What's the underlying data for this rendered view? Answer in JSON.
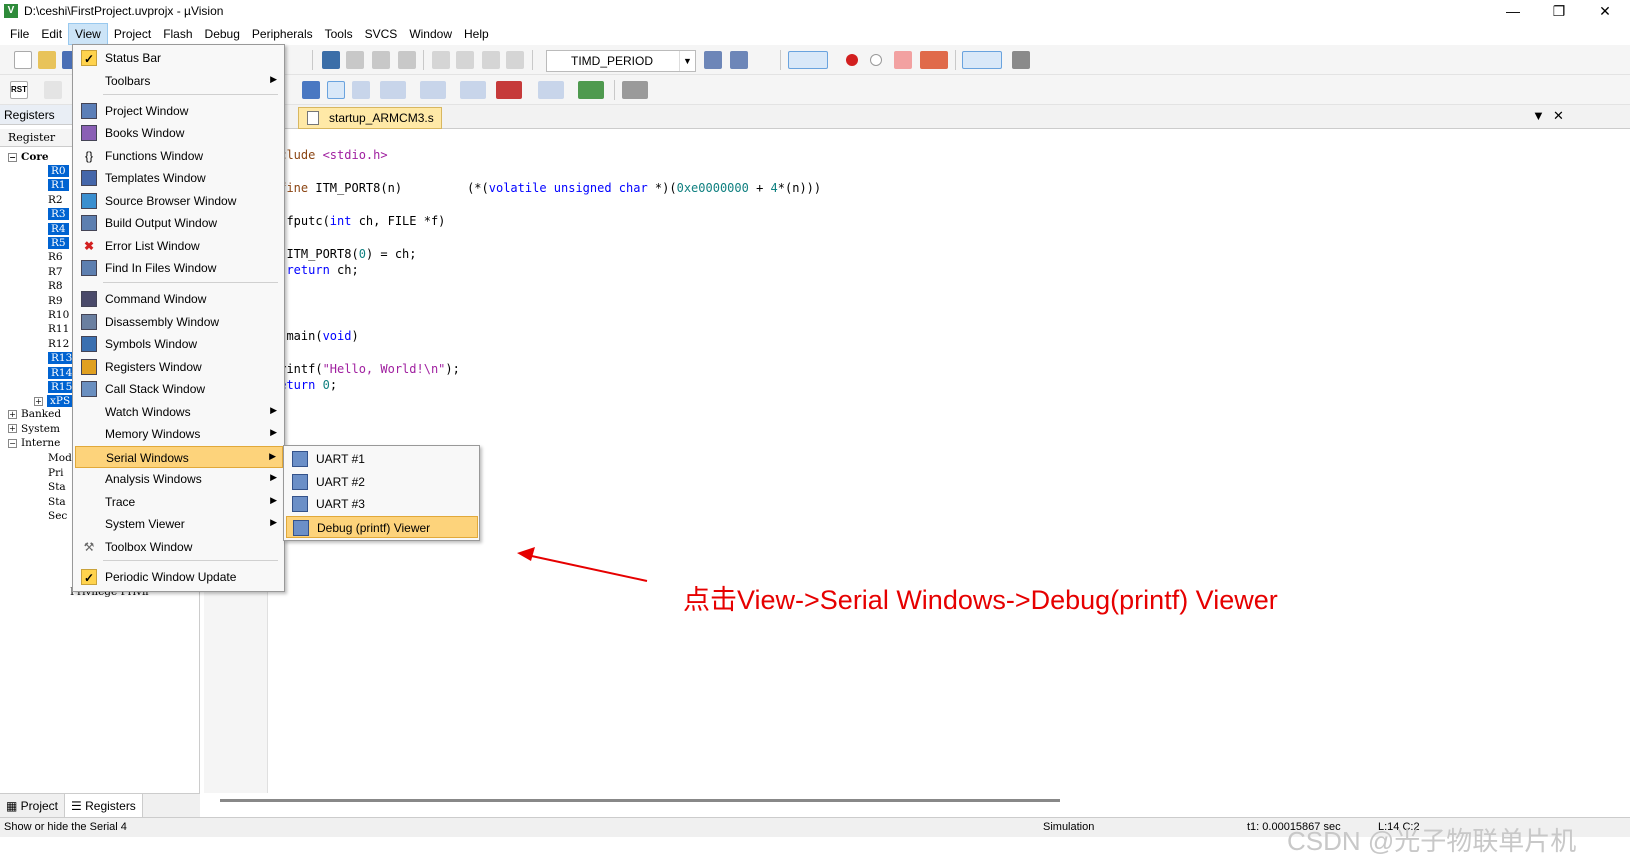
{
  "window": {
    "title": "D:\\ceshi\\FirstProject.uvprojx - µVision",
    "min": "—",
    "max": "❐",
    "close": "✕"
  },
  "menubar": [
    "File",
    "Edit",
    "View",
    "Project",
    "Flash",
    "Debug",
    "Peripherals",
    "Tools",
    "SVCS",
    "Window",
    "Help"
  ],
  "toolbar": {
    "target_combo": "TIMD_PERIOD",
    "rst_label": "RST"
  },
  "left_panel": {
    "title": "Registers",
    "header": "Register",
    "core_label": "Core",
    "registers": [
      "R0",
      "R1",
      "R2",
      "R3",
      "R4",
      "R5",
      "R6",
      "R7",
      "R8",
      "R9",
      "R10",
      "R11",
      "R12",
      "R13",
      "R14",
      "R15",
      "xPS"
    ],
    "groups": [
      "Banked",
      "System",
      "Interne"
    ],
    "internal_children": [
      "Mod",
      "Pri",
      "Sta",
      "Sta",
      "Sec"
    ],
    "partial_row": "Privilege   Privil"
  },
  "bottom_tabs": [
    "Project",
    "Registers"
  ],
  "editor": {
    "tab": "startup_ARMCM3.s",
    "lines": [
      {
        "segments": [
          {
            "t": "nclude ",
            "c": "pp"
          },
          {
            "t": "<stdio.h>",
            "c": "str"
          }
        ]
      },
      {
        "segments": [
          {
            "t": "efine ",
            "c": "pp"
          },
          {
            "t": "ITM_PORT8(n)         (*(",
            "c": ""
          },
          {
            "t": "volatile unsigned char",
            "c": "kw"
          },
          {
            "t": " *)(",
            "c": ""
          },
          {
            "t": "0xe0000000",
            "c": "num"
          },
          {
            "t": " + ",
            "c": ""
          },
          {
            "t": "4",
            "c": "num"
          },
          {
            "t": "*(n)))",
            "c": ""
          }
        ]
      },
      {
        "segments": [
          {
            "t": "t fputc(",
            "c": ""
          },
          {
            "t": "int",
            "c": "kw"
          },
          {
            "t": " ch, FILE *f)",
            "c": ""
          }
        ]
      },
      {
        "segments": [
          {
            "t": "  ITM_PORT8(",
            "c": ""
          },
          {
            "t": "0",
            "c": "num"
          },
          {
            "t": ") = ch;",
            "c": ""
          }
        ]
      },
      {
        "segments": [
          {
            "t": "  ",
            "c": ""
          },
          {
            "t": "return",
            "c": "kw"
          },
          {
            "t": " ch;",
            "c": ""
          }
        ]
      },
      {
        "segments": [
          {
            "t": "t main(",
            "c": ""
          },
          {
            "t": "void",
            "c": "kw"
          },
          {
            "t": ")",
            "c": ""
          }
        ]
      },
      {
        "segments": [
          {
            "t": "printf(",
            "c": ""
          },
          {
            "t": "\"Hello, World!\\n\"",
            "c": "str"
          },
          {
            "t": ");",
            "c": ""
          }
        ]
      },
      {
        "segments": [
          {
            "t": "return",
            "c": "kw"
          },
          {
            "t": " ",
            "c": ""
          },
          {
            "t": "0",
            "c": "num"
          },
          {
            "t": ";",
            "c": ""
          }
        ]
      }
    ]
  },
  "view_menu": {
    "items": [
      {
        "label": "Status Bar",
        "icon": "check-icon",
        "checked": true
      },
      {
        "label": "Toolbars",
        "submenu": true
      },
      {
        "label": "Project Window",
        "icon": "project-window-icon"
      },
      {
        "label": "Books Window",
        "icon": "books-icon"
      },
      {
        "label": "Functions Window",
        "icon": "braces-icon"
      },
      {
        "label": "Templates Window",
        "icon": "templates-icon"
      },
      {
        "label": "Source Browser Window",
        "icon": "source-browser-icon"
      },
      {
        "label": "Build Output Window",
        "icon": "build-output-icon"
      },
      {
        "label": "Error List Window",
        "icon": "error-list-icon"
      },
      {
        "label": "Find In Files Window",
        "icon": "find-in-files-icon"
      },
      {
        "label": "Command Window",
        "icon": "command-icon"
      },
      {
        "label": "Disassembly Window",
        "icon": "disassembly-icon"
      },
      {
        "label": "Symbols Window",
        "icon": "symbols-icon"
      },
      {
        "label": "Registers Window",
        "icon": "registers-icon"
      },
      {
        "label": "Call Stack Window",
        "icon": "call-stack-icon"
      },
      {
        "label": "Watch Windows",
        "submenu": true
      },
      {
        "label": "Memory Windows",
        "submenu": true
      },
      {
        "label": "Serial Windows",
        "submenu": true,
        "highlighted": true
      },
      {
        "label": "Analysis Windows",
        "submenu": true
      },
      {
        "label": "Trace",
        "submenu": true
      },
      {
        "label": "System Viewer",
        "submenu": true
      },
      {
        "label": "Toolbox Window",
        "icon": "toolbox-icon"
      },
      {
        "label": "Periodic Window Update",
        "icon": "check-icon",
        "checked": true
      }
    ]
  },
  "serial_submenu": [
    "UART #1",
    "UART #2",
    "UART #3",
    "Debug (printf) Viewer"
  ],
  "annotation": "点击View->Serial Windows->Debug(printf) Viewer",
  "status": {
    "left": "Show or hide the Serial 4",
    "mode": "Simulation",
    "time": "t1: 0.00015867 sec",
    "pos": "L:14 C:2"
  },
  "watermark": "CSDN @光子物联单片机"
}
